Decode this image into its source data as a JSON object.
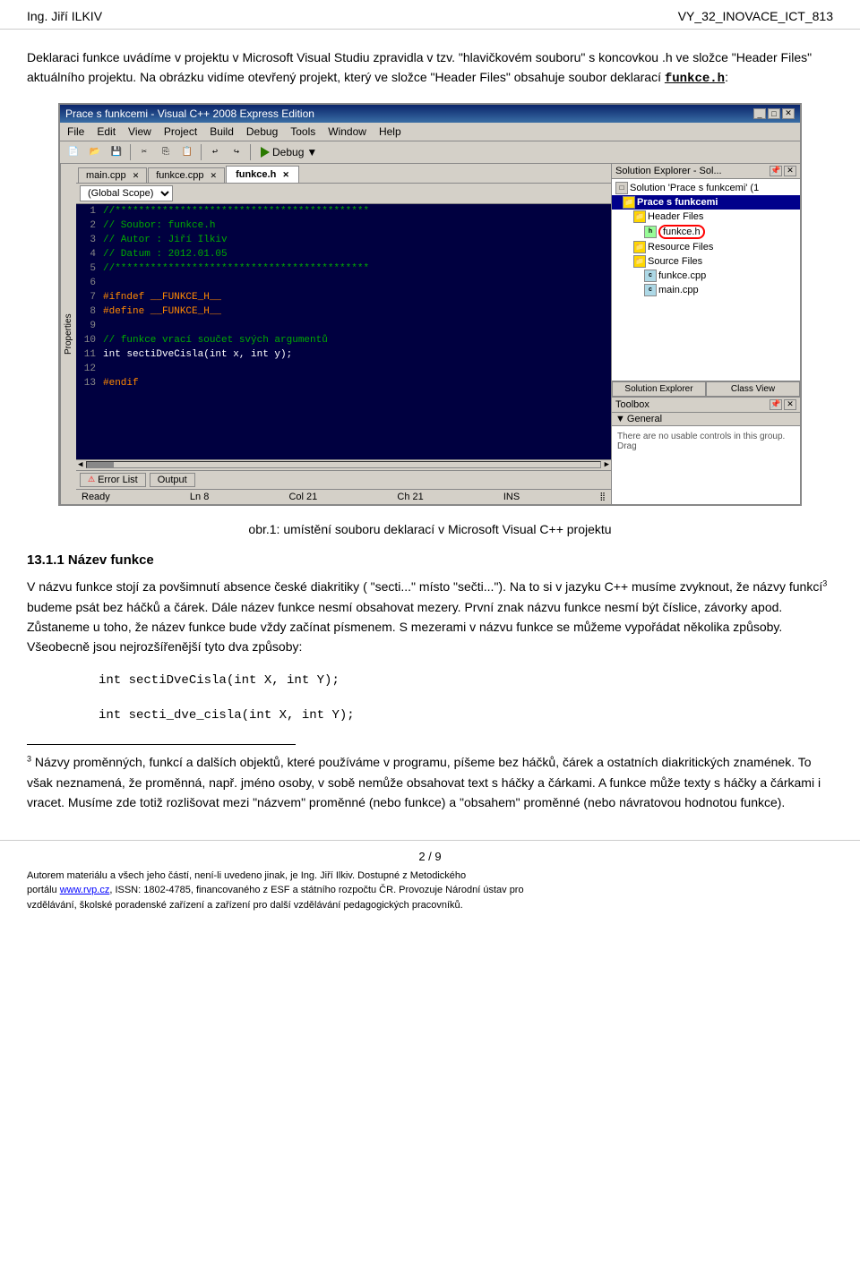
{
  "header": {
    "left": "Ing. Jiří ILKIV",
    "right": "VY_32_INOVACE_ICT_813"
  },
  "paragraphs": {
    "p1": "Deklaraci funkce uvádíme v projektu v Microsoft Visual Studiu zpravidla v tzv. \"hlavičkovém souboru\" s koncovkou .h ve složce \"Header Files\" aktuálního projektu. Na obrázku vidíme otevřený projekt, který ve složce \"Header Files\" obsahuje soubor deklarací ",
    "p1_code": "funkce.h",
    "p1_suffix": ":"
  },
  "ide": {
    "title": "Prace s funkcemi - Visual C++ 2008 Express Edition",
    "menu": [
      "File",
      "Edit",
      "View",
      "Project",
      "Build",
      "Debug",
      "Tools",
      "Window",
      "Help"
    ],
    "toolbar_debug": "Debug",
    "tabs": [
      "main.cpp",
      "funkce.cpp",
      "funkce.h"
    ],
    "active_tab": "funkce.h",
    "scope": "(Global Scope)",
    "code_lines": [
      {
        "num": "1",
        "content": "//***************************************",
        "type": "comment"
      },
      {
        "num": "2",
        "content": "// Soubor: funkce.h",
        "type": "comment"
      },
      {
        "num": "3",
        "content": "// Autor : Jiří Ilkiv",
        "type": "comment"
      },
      {
        "num": "4",
        "content": "// Datum : 2012.01.05",
        "type": "comment"
      },
      {
        "num": "5",
        "content": "//***************************************",
        "type": "comment"
      },
      {
        "num": "6",
        "content": "",
        "type": "normal"
      },
      {
        "num": "7",
        "content": "#ifndef __FUNKCE_H__",
        "type": "preprocessor"
      },
      {
        "num": "8",
        "content": "#define __FUNKCE_H__",
        "type": "preprocessor"
      },
      {
        "num": "9",
        "content": "",
        "type": "normal"
      },
      {
        "num": "10",
        "content": "// funkce vrací součet svých argumentů",
        "type": "comment"
      },
      {
        "num": "11",
        "content": "int sectiDveCisla(int x, int y);",
        "type": "normal"
      },
      {
        "num": "12",
        "content": "",
        "type": "normal"
      },
      {
        "num": "13",
        "content": "#endif",
        "type": "preprocessor"
      }
    ],
    "solution_explorer": {
      "title": "Solution Explorer - Sol...",
      "items": [
        {
          "level": 0,
          "icon": "solution",
          "text": "Solution 'Prace s funkcemi' (1",
          "type": "solution"
        },
        {
          "level": 1,
          "icon": "folder",
          "text": "Prace s funkcemi",
          "type": "project",
          "highlighted": true
        },
        {
          "level": 2,
          "icon": "folder",
          "text": "Header Files",
          "type": "folder"
        },
        {
          "level": 3,
          "icon": "h-file",
          "text": "funkce.h",
          "type": "hfile",
          "circled": true
        },
        {
          "level": 2,
          "icon": "folder",
          "text": "Resource Files",
          "type": "folder"
        },
        {
          "level": 2,
          "icon": "folder",
          "text": "Source Files",
          "type": "folder"
        },
        {
          "level": 3,
          "icon": "cpp-file",
          "text": "funkce.cpp",
          "type": "cppfile"
        },
        {
          "level": 3,
          "icon": "cpp-file",
          "text": "main.cpp",
          "type": "cppfile"
        }
      ],
      "tabs": [
        "Solution Explorer",
        "Class View"
      ]
    },
    "toolbox": {
      "title": "Toolbox",
      "section": "General",
      "content": "There are no usable controls in this group. Drag"
    },
    "bottom_tabs": [
      "Error List",
      "Output"
    ],
    "statusbar": {
      "status": "Ready",
      "ln": "Ln 8",
      "col": "Col 21",
      "ch": "Ch 21",
      "ins": "INS"
    }
  },
  "caption": "obr.1:  umístění souboru deklarací v Microsoft Visual C++ projektu",
  "section": {
    "number": "13.1.1",
    "title": "Název funkce"
  },
  "body_text": {
    "p1": "V názvu funkce stojí za povšimnutí  absence české diakritiky ( \"secti...\" místo \"sečti...\"). Na to si v jazyku C++ musíme zvyknout, že názvy funkcí",
    "p1_sup": "3",
    "p1_cont": " budeme psát bez háčků a čárek. Dále název funkce nesmí obsahovat mezery. První znak názvu funkce nesmí být číslice, závorky apod. Zůstaneme u toho, že název funkce bude vždy začínat písmenem. S mezerami v názvu funkce se můžeme vypořádat několika způsoby. Všeobecně jsou nejrozšířenější tyto dva způsoby:",
    "code1": "int sectiDveCisla(int X,  int Y);",
    "code2": "int secti_dve_cisla(int X,  int Y);"
  },
  "footnotes": {
    "divider": true,
    "fn3_num": "3",
    "fn3_text": "Názvy proměnných, funkcí a dalších objektů, které používáme v programu, píšeme bez háčků, čárek a ostatních diakritických znamének. To však neznamená, že proměnná, např. jméno osoby, v sobě nemůže obsahovat text s háčky a čárkami. A funkce může texty s háčky a čárkami i vracet.  Musíme zde totiž rozlišovat mezi \"názvem\" proměnné (nebo funkce) a \"obsahem\" proměnné (nebo návratovou hodnotou funkce)."
  },
  "footer": {
    "page": "2 / 9",
    "line1": "Autorem materiálu a všech jeho částí, není-li uvedeno jinak, je Ing. Jiří Ilkiv. Dostupné z Metodického",
    "line2_pre": "portálu ",
    "line2_link": "www.rvp.cz",
    "line2_mid": ", ISSN: 1802-4785, financovaného z ESF a státního rozpočtu ČR. Provozuje Národní ústav pro",
    "line3": "vzdělávání, školské poradenské zařízení a zařízení pro další vzdělávání pedagogických pracovníků."
  }
}
